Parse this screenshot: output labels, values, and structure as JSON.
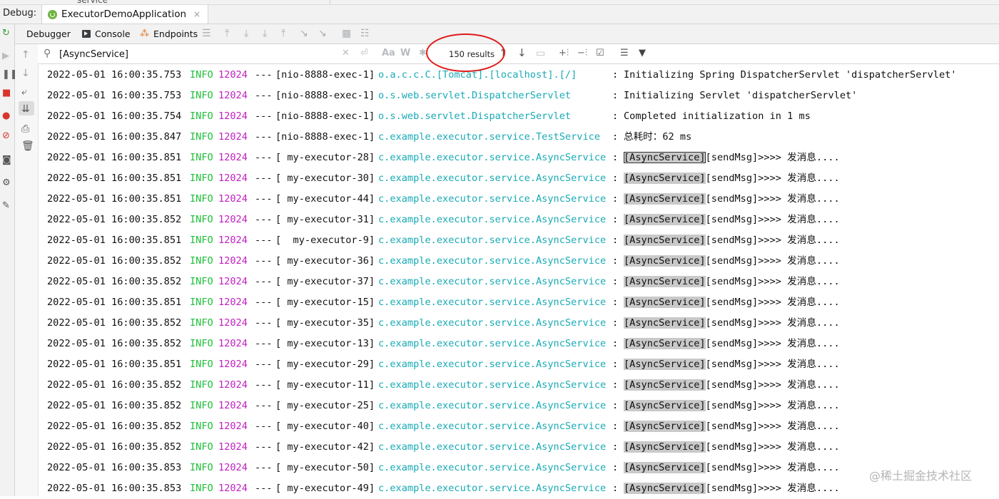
{
  "top_strip": {
    "text": "service"
  },
  "debug_bar": {
    "label": "Debug:",
    "tab_title": "ExecutorDemoApplication",
    "close": "×"
  },
  "toolbar": {
    "debugger": "Debugger",
    "console": "Console",
    "endpoints": "Endpoints"
  },
  "search": {
    "value": "[AsyncService]",
    "results": "150 results",
    "match_case": "Aa",
    "words": "W"
  },
  "log": {
    "rows": [
      {
        "ts": "2022-05-01 16:00:35.753",
        "level": "INFO",
        "pid": "12024",
        "dash": "---",
        "thread": "[nio-8888-exec-1]",
        "cls": "o.a.c.c.C.[Tomcat].[localhost].[/]",
        "msg": "Initializing Spring DispatcherServlet 'dispatcherServlet'",
        "hl": "",
        "rest": ""
      },
      {
        "ts": "2022-05-01 16:00:35.753",
        "level": "INFO",
        "pid": "12024",
        "dash": "---",
        "thread": "[nio-8888-exec-1]",
        "cls": "o.s.web.servlet.DispatcherServlet",
        "msg": "Initializing Servlet 'dispatcherServlet'",
        "hl": "",
        "rest": ""
      },
      {
        "ts": "2022-05-01 16:00:35.754",
        "level": "INFO",
        "pid": "12024",
        "dash": "---",
        "thread": "[nio-8888-exec-1]",
        "cls": "o.s.web.servlet.DispatcherServlet",
        "msg": "Completed initialization in 1 ms",
        "hl": "",
        "rest": ""
      },
      {
        "ts": "2022-05-01 16:00:35.847",
        "level": "INFO",
        "pid": "12024",
        "dash": "---",
        "thread": "[nio-8888-exec-1]",
        "cls": "c.example.executor.service.TestService",
        "msg": "总耗时：62 ms",
        "hl": "",
        "rest": ""
      },
      {
        "ts": "2022-05-01 16:00:35.851",
        "level": "INFO",
        "pid": "12024",
        "dash": "---",
        "thread": "[ my-executor-28]",
        "cls": "c.example.executor.service.AsyncService",
        "msg": "",
        "hl": "[AsyncService]",
        "rest": "[sendMsg]>>>> 发消息....",
        "current": true
      },
      {
        "ts": "2022-05-01 16:00:35.851",
        "level": "INFO",
        "pid": "12024",
        "dash": "---",
        "thread": "[ my-executor-30]",
        "cls": "c.example.executor.service.AsyncService",
        "msg": "",
        "hl": "[AsyncService]",
        "rest": "[sendMsg]>>>> 发消息...."
      },
      {
        "ts": "2022-05-01 16:00:35.851",
        "level": "INFO",
        "pid": "12024",
        "dash": "---",
        "thread": "[ my-executor-44]",
        "cls": "c.example.executor.service.AsyncService",
        "msg": "",
        "hl": "[AsyncService]",
        "rest": "[sendMsg]>>>> 发消息...."
      },
      {
        "ts": "2022-05-01 16:00:35.852",
        "level": "INFO",
        "pid": "12024",
        "dash": "---",
        "thread": "[ my-executor-31]",
        "cls": "c.example.executor.service.AsyncService",
        "msg": "",
        "hl": "[AsyncService]",
        "rest": "[sendMsg]>>>> 发消息...."
      },
      {
        "ts": "2022-05-01 16:00:35.851",
        "level": "INFO",
        "pid": "12024",
        "dash": "---",
        "thread": "[  my-executor-9]",
        "cls": "c.example.executor.service.AsyncService",
        "msg": "",
        "hl": "[AsyncService]",
        "rest": "[sendMsg]>>>> 发消息...."
      },
      {
        "ts": "2022-05-01 16:00:35.852",
        "level": "INFO",
        "pid": "12024",
        "dash": "---",
        "thread": "[ my-executor-36]",
        "cls": "c.example.executor.service.AsyncService",
        "msg": "",
        "hl": "[AsyncService]",
        "rest": "[sendMsg]>>>> 发消息...."
      },
      {
        "ts": "2022-05-01 16:00:35.852",
        "level": "INFO",
        "pid": "12024",
        "dash": "---",
        "thread": "[ my-executor-37]",
        "cls": "c.example.executor.service.AsyncService",
        "msg": "",
        "hl": "[AsyncService]",
        "rest": "[sendMsg]>>>> 发消息...."
      },
      {
        "ts": "2022-05-01 16:00:35.851",
        "level": "INFO",
        "pid": "12024",
        "dash": "---",
        "thread": "[ my-executor-15]",
        "cls": "c.example.executor.service.AsyncService",
        "msg": "",
        "hl": "[AsyncService]",
        "rest": "[sendMsg]>>>> 发消息...."
      },
      {
        "ts": "2022-05-01 16:00:35.852",
        "level": "INFO",
        "pid": "12024",
        "dash": "---",
        "thread": "[ my-executor-35]",
        "cls": "c.example.executor.service.AsyncService",
        "msg": "",
        "hl": "[AsyncService]",
        "rest": "[sendMsg]>>>> 发消息...."
      },
      {
        "ts": "2022-05-01 16:00:35.852",
        "level": "INFO",
        "pid": "12024",
        "dash": "---",
        "thread": "[ my-executor-13]",
        "cls": "c.example.executor.service.AsyncService",
        "msg": "",
        "hl": "[AsyncService]",
        "rest": "[sendMsg]>>>> 发消息...."
      },
      {
        "ts": "2022-05-01 16:00:35.851",
        "level": "INFO",
        "pid": "12024",
        "dash": "---",
        "thread": "[ my-executor-29]",
        "cls": "c.example.executor.service.AsyncService",
        "msg": "",
        "hl": "[AsyncService]",
        "rest": "[sendMsg]>>>> 发消息...."
      },
      {
        "ts": "2022-05-01 16:00:35.852",
        "level": "INFO",
        "pid": "12024",
        "dash": "---",
        "thread": "[ my-executor-11]",
        "cls": "c.example.executor.service.AsyncService",
        "msg": "",
        "hl": "[AsyncService]",
        "rest": "[sendMsg]>>>> 发消息...."
      },
      {
        "ts": "2022-05-01 16:00:35.852",
        "level": "INFO",
        "pid": "12024",
        "dash": "---",
        "thread": "[ my-executor-25]",
        "cls": "c.example.executor.service.AsyncService",
        "msg": "",
        "hl": "[AsyncService]",
        "rest": "[sendMsg]>>>> 发消息...."
      },
      {
        "ts": "2022-05-01 16:00:35.852",
        "level": "INFO",
        "pid": "12024",
        "dash": "---",
        "thread": "[ my-executor-40]",
        "cls": "c.example.executor.service.AsyncService",
        "msg": "",
        "hl": "[AsyncService]",
        "rest": "[sendMsg]>>>> 发消息...."
      },
      {
        "ts": "2022-05-01 16:00:35.852",
        "level": "INFO",
        "pid": "12024",
        "dash": "---",
        "thread": "[ my-executor-42]",
        "cls": "c.example.executor.service.AsyncService",
        "msg": "",
        "hl": "[AsyncService]",
        "rest": "[sendMsg]>>>> 发消息...."
      },
      {
        "ts": "2022-05-01 16:00:35.853",
        "level": "INFO",
        "pid": "12024",
        "dash": "---",
        "thread": "[ my-executor-50]",
        "cls": "c.example.executor.service.AsyncService",
        "msg": "",
        "hl": "[AsyncService]",
        "rest": "[sendMsg]>>>> 发消息...."
      },
      {
        "ts": "2022-05-01 16:00:35.853",
        "level": "INFO",
        "pid": "12024",
        "dash": "---",
        "thread": "[ my-executor-49]",
        "cls": "c.example.executor.service.AsyncService",
        "msg": "",
        "hl": "[AsyncService]",
        "rest": "[sendMsg]>>>> 发消息...."
      }
    ]
  },
  "watermark": "@稀土掘金技术社区",
  "colors": {
    "level": "#1fbf3a",
    "pid": "#c021c0",
    "class": "#19aab5",
    "highlight": "#c9c9c9",
    "annotation": "#e01b1b"
  }
}
